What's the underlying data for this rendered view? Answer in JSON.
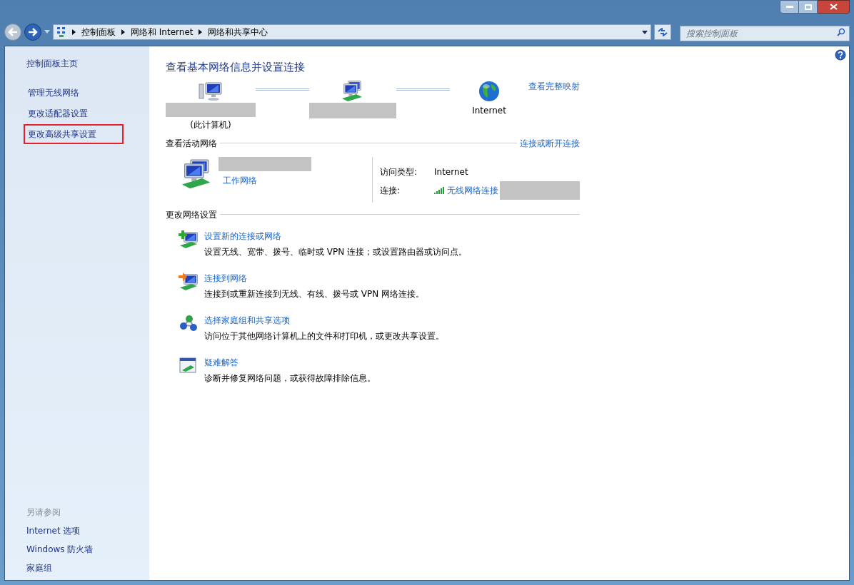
{
  "address_bar": {
    "crumbs": [
      "控制面板",
      "网络和 Internet",
      "网络和共享中心"
    ]
  },
  "search": {
    "placeholder": "搜索控制面板"
  },
  "sidebar": {
    "home": "控制面板主页",
    "items": [
      {
        "label": "管理无线网络",
        "outlined": false
      },
      {
        "label": "更改适配器设置",
        "outlined": false
      },
      {
        "label": "更改高级共享设置",
        "outlined": true
      }
    ],
    "see_also": {
      "heading": "另请参阅",
      "links": [
        "Internet 选项",
        "Windows 防火墙",
        "家庭组"
      ]
    }
  },
  "main": {
    "title": "查看基本网络信息并设置连接",
    "map_link": "查看完整映射",
    "nodes": [
      {
        "kind": "computer",
        "caption": "(此计算机)"
      },
      {
        "kind": "network"
      },
      {
        "kind": "globe",
        "caption": "Internet"
      }
    ],
    "active": {
      "heading": "查看活动网络",
      "link": "连接或断开连接",
      "network_type": "工作网络",
      "rows": [
        {
          "label": "访问类型:",
          "kind": "text",
          "value": "Internet"
        },
        {
          "label": "连接:",
          "kind": "wifi",
          "value": "无线网络连接"
        }
      ]
    },
    "change": {
      "heading": "更改网络设置",
      "tasks": [
        {
          "kind": "new",
          "title": "设置新的连接或网络",
          "desc": "设置无线、宽带、拨号、临时或 VPN 连接；或设置路由器或访问点。"
        },
        {
          "kind": "connect",
          "title": "连接到网络",
          "desc": "连接到或重新连接到无线、有线、拨号或 VPN 网络连接。"
        },
        {
          "kind": "homegroup",
          "title": "选择家庭组和共享选项",
          "desc": "访问位于其他网络计算机上的文件和打印机，或更改共享设置。"
        },
        {
          "kind": "troubleshoot",
          "title": "疑难解答",
          "desc": "诊断并修复网络问题，或获得故障排除信息。"
        }
      ]
    }
  }
}
